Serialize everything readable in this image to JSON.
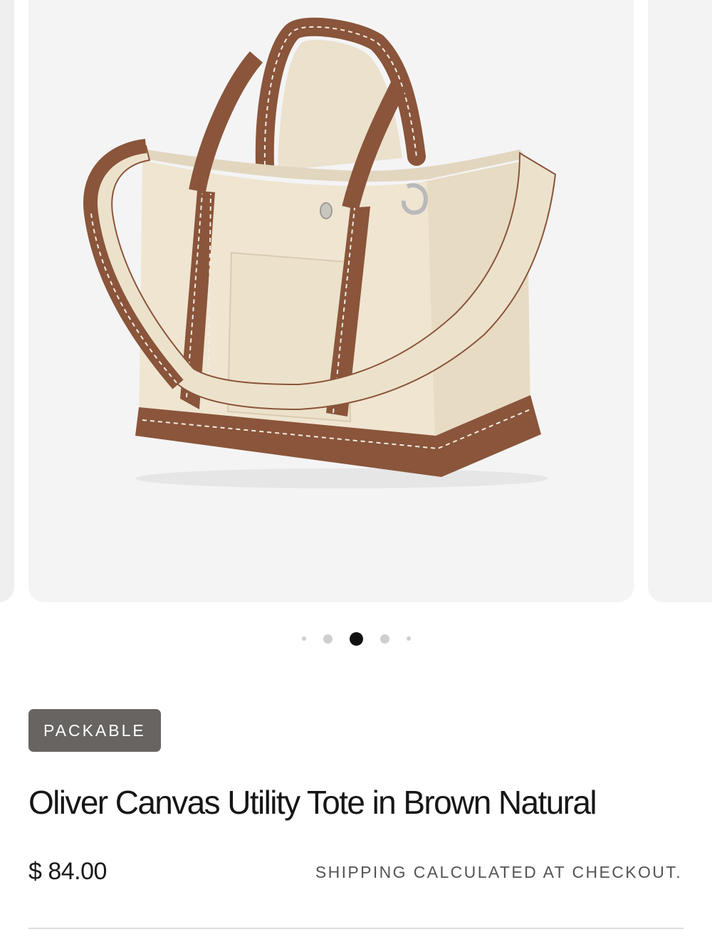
{
  "product": {
    "badge": "PACKABLE",
    "title": "Oliver Canvas Utility Tote in Brown Natural",
    "price": "$ 84.00",
    "shipping_note": "SHIPPING CALCULATED AT CHECKOUT."
  },
  "carousel": {
    "active_index": 2,
    "dot_count": 5,
    "image_subject": "canvas tote bag with brown handles and shoulder strap"
  },
  "colors": {
    "canvas": "#efe7d6",
    "trim_brown": "#8a553a",
    "badge_bg": "#676462",
    "image_bg": "#f4f4f5",
    "active_dot": "#111111",
    "inactive_dot": "#cfcfd1"
  }
}
